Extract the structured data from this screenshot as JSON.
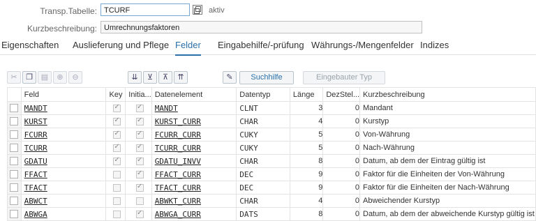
{
  "header": {
    "table_label": "Transp.Tabelle:",
    "table_value": "TCURF",
    "status": "aktiv",
    "desc_label": "Kurzbeschreibung:",
    "desc_value": "Umrechnungsfaktoren"
  },
  "tabs": [
    {
      "label": "Eigenschaften"
    },
    {
      "label": "Auslieferung und Pflege"
    },
    {
      "label": "Felder"
    },
    {
      "label": "Eingabehilfe/-prüfung"
    },
    {
      "label": "Währungs-/Mengenfelder"
    },
    {
      "label": "Indizes"
    }
  ],
  "toolbar": {
    "icons": [
      "cut-icon",
      "copy-icon",
      "paste-icon",
      "insert-row-icon",
      "delete-row-icon",
      "first-icon",
      "previous-icon",
      "next-icon",
      "last-icon",
      "where-used-icon"
    ],
    "search_help": "Suchhilfe",
    "builtin_type": "Eingebauter Typ"
  },
  "columns": [
    "Feld",
    "Key",
    "Initia...",
    "Datenelement",
    "Datentyp",
    "Länge",
    "DezStel...",
    "Kurzbeschreibung"
  ],
  "rows": [
    {
      "feld": "MANDT",
      "key": true,
      "init": true,
      "dtel": "MANDT",
      "type": "CLNT",
      "len": "3",
      "dec": "0",
      "desc": "Mandant"
    },
    {
      "feld": "KURST",
      "key": true,
      "init": true,
      "dtel": "KURST_CURR",
      "type": "CHAR",
      "len": "4",
      "dec": "0",
      "desc": "Kurstyp"
    },
    {
      "feld": "FCURR",
      "key": true,
      "init": true,
      "dtel": "FCURR_CURR",
      "type": "CUKY",
      "len": "5",
      "dec": "0",
      "desc": "Von-Währung"
    },
    {
      "feld": "TCURR",
      "key": true,
      "init": true,
      "dtel": "TCURR_CURR",
      "type": "CUKY",
      "len": "5",
      "dec": "0",
      "desc": "Nach-Währung"
    },
    {
      "feld": "GDATU",
      "key": true,
      "init": true,
      "dtel": "GDATU_INVV",
      "type": "CHAR",
      "len": "8",
      "dec": "0",
      "desc": "Datum, ab dem der Eintrag gültig ist"
    },
    {
      "feld": "FFACT",
      "key": false,
      "init": true,
      "dtel": "FFACT_CURR",
      "type": "DEC",
      "len": "9",
      "dec": "0",
      "desc": "Faktor für die Einheiten der Von-Währung"
    },
    {
      "feld": "TFACT",
      "key": false,
      "init": true,
      "dtel": "TFACT_CURR",
      "type": "DEC",
      "len": "9",
      "dec": "0",
      "desc": "Faktor für die Einheiten der Nach-Währung"
    },
    {
      "feld": "ABWCT",
      "key": false,
      "init": false,
      "dtel": "ABWKT_CURR",
      "type": "CHAR",
      "len": "4",
      "dec": "0",
      "desc": "Abweichender Kurstyp"
    },
    {
      "feld": "ABWGA",
      "key": false,
      "init": true,
      "dtel": "ABWGA_CURR",
      "type": "DATS",
      "len": "8",
      "dec": "0",
      "desc": "Datum, ab dem der abweichende Kurstyp gültig ist"
    }
  ]
}
